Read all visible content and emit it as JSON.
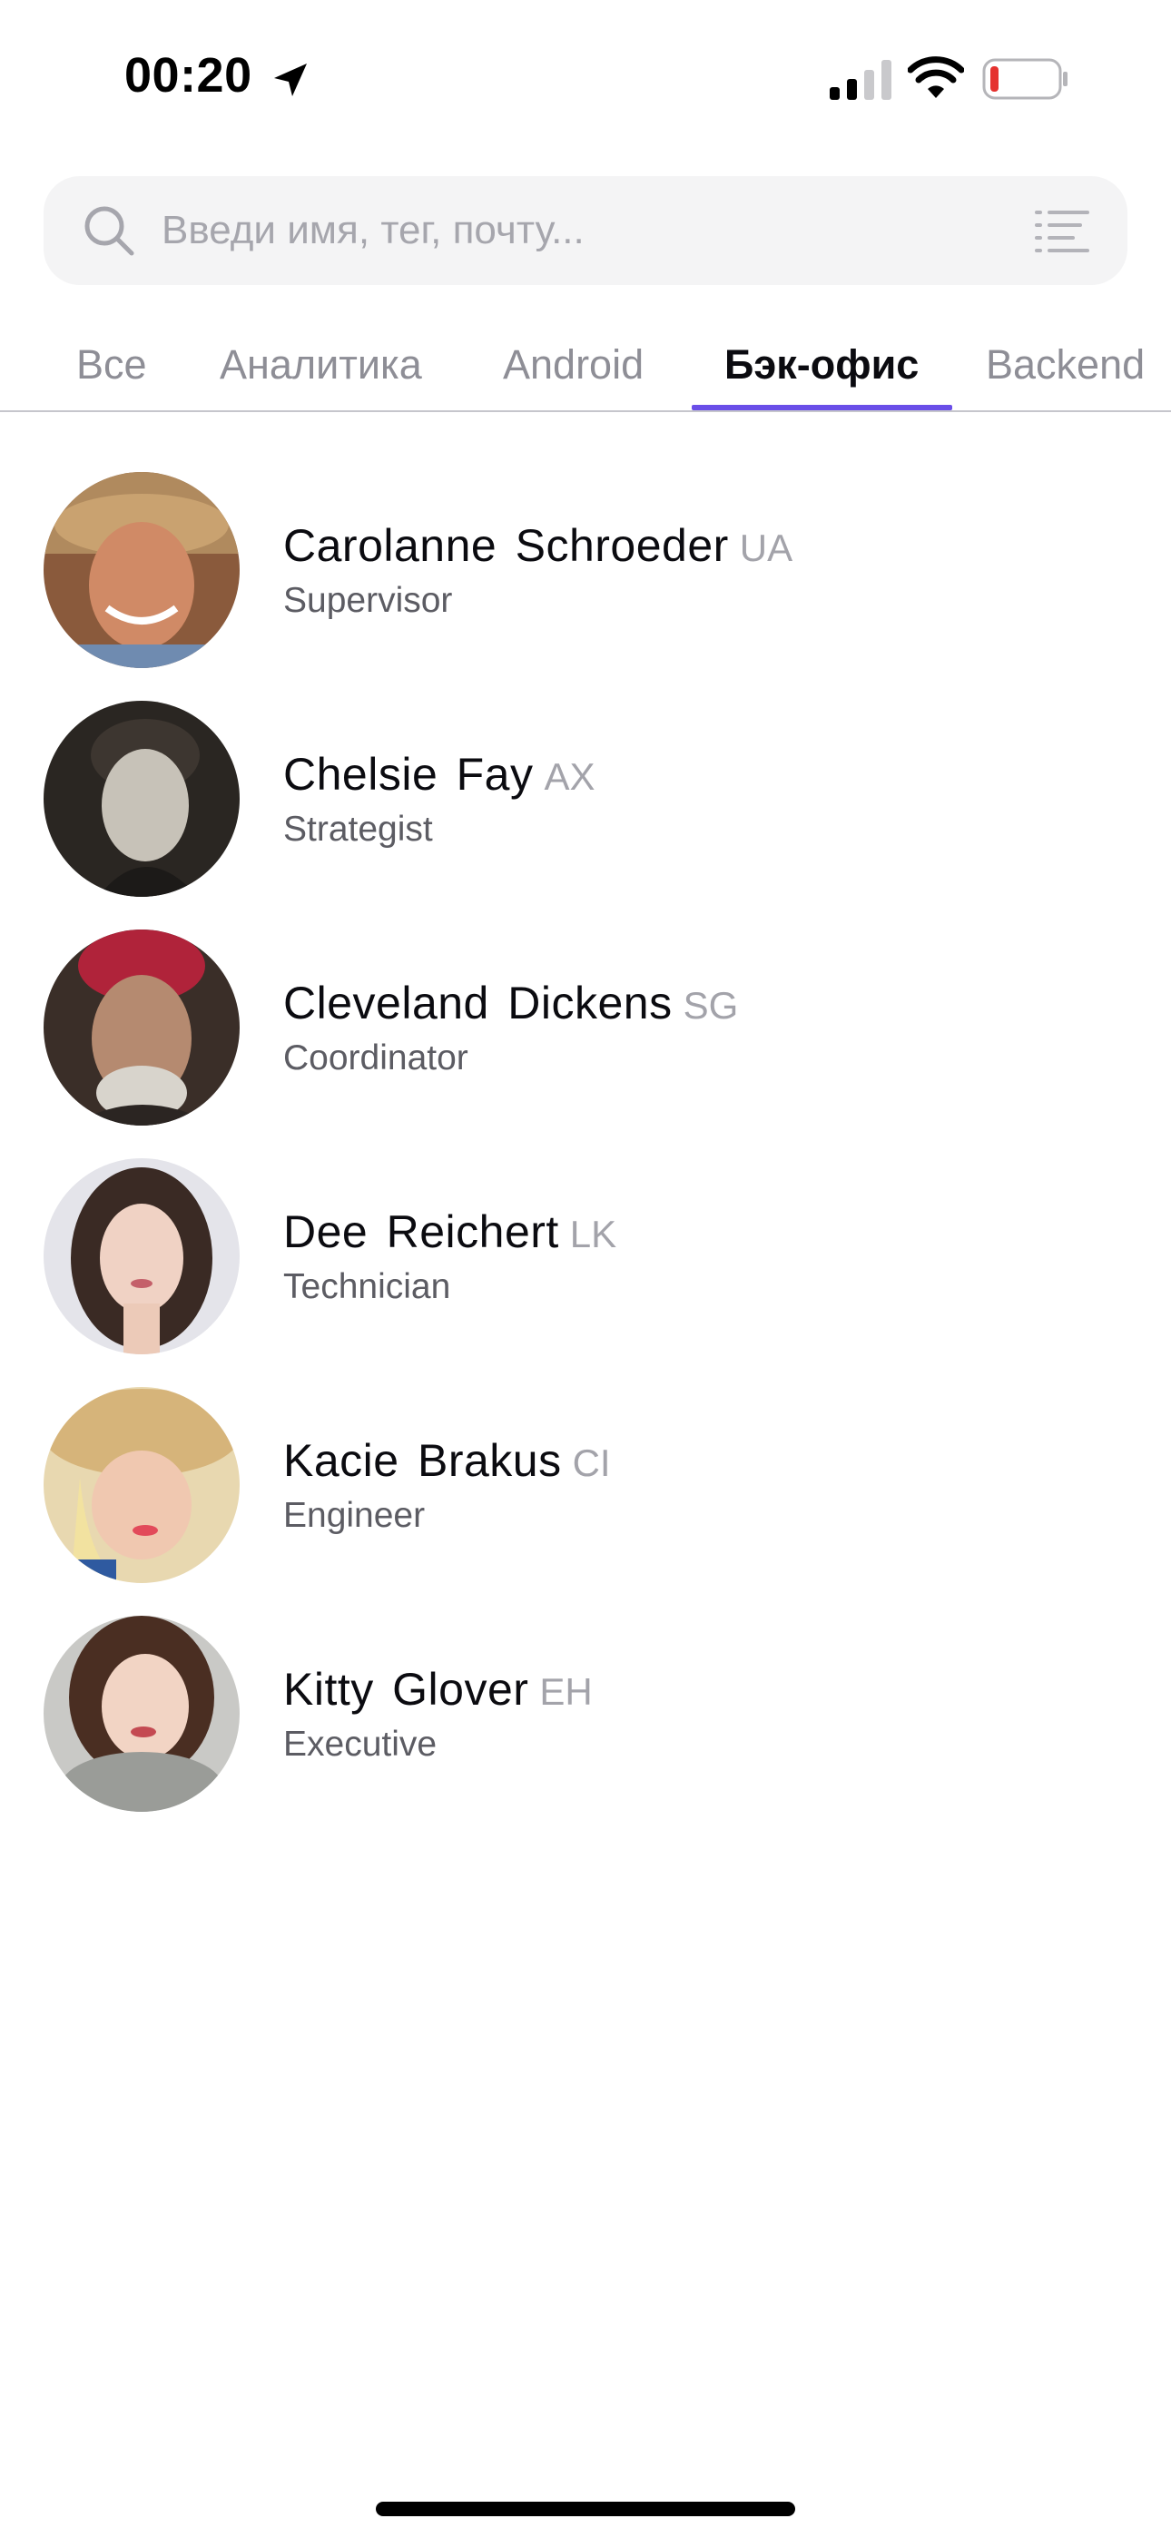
{
  "status_bar": {
    "time": "00:20",
    "battery_color": "#e5322f"
  },
  "search": {
    "placeholder": "Введи имя, тег, почту...",
    "value": ""
  },
  "tabs": [
    {
      "label": "Все",
      "active": false
    },
    {
      "label": "Аналитика",
      "active": false
    },
    {
      "label": "Android",
      "active": false
    },
    {
      "label": "Бэк-офис",
      "active": true
    },
    {
      "label": "Backend",
      "active": false
    }
  ],
  "accent_color": "#6a4ee8",
  "people": [
    {
      "name": "Carolanne Schroeder",
      "code": "UA",
      "role": "Supervisor"
    },
    {
      "name": "Chelsie Fay",
      "code": "AX",
      "role": "Strategist"
    },
    {
      "name": "Cleveland Dickens",
      "code": "SG",
      "role": "Coordinator"
    },
    {
      "name": "Dee Reichert",
      "code": "LK",
      "role": "Technician"
    },
    {
      "name": "Kacie Brakus",
      "code": "CI",
      "role": "Engineer"
    },
    {
      "name": "Kitty Glover",
      "code": "EH",
      "role": "Executive"
    }
  ]
}
